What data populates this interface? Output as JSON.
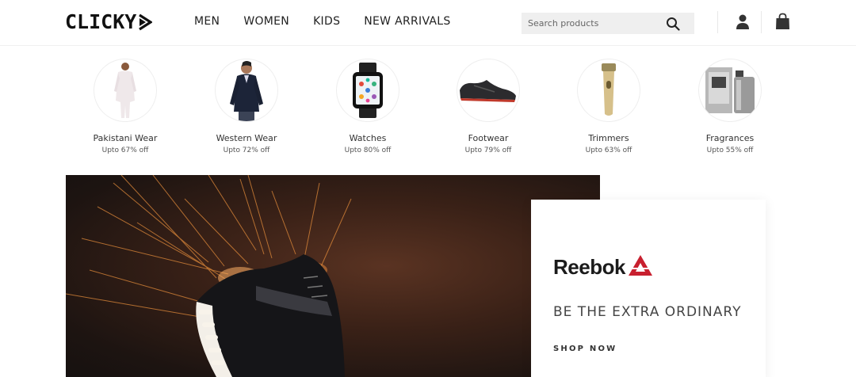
{
  "header": {
    "logo_text": "CLICKY",
    "nav": [
      "MEN",
      "WOMEN",
      "KIDS",
      "NEW ARRIVALS"
    ],
    "search": {
      "placeholder": "Search products"
    }
  },
  "categories": [
    {
      "label": "Pakistani Wear",
      "offer": "Upto 67% off"
    },
    {
      "label": "Western Wear",
      "offer": "Upto 72% off"
    },
    {
      "label": "Watches",
      "offer": "Upto 80% off"
    },
    {
      "label": "Footwear",
      "offer": "Upto 79% off"
    },
    {
      "label": "Trimmers",
      "offer": "Upto 63% off"
    },
    {
      "label": "Fragrances",
      "offer": "Upto 55% off"
    }
  ],
  "promo": {
    "brand": "Reebok",
    "tagline": "BE THE EXTRA ORDINARY",
    "cta": "SHOP NOW"
  },
  "colors": {
    "brand_red": "#c8202f",
    "hero_bg": "#3a2117",
    "search_bg": "#efefef"
  }
}
